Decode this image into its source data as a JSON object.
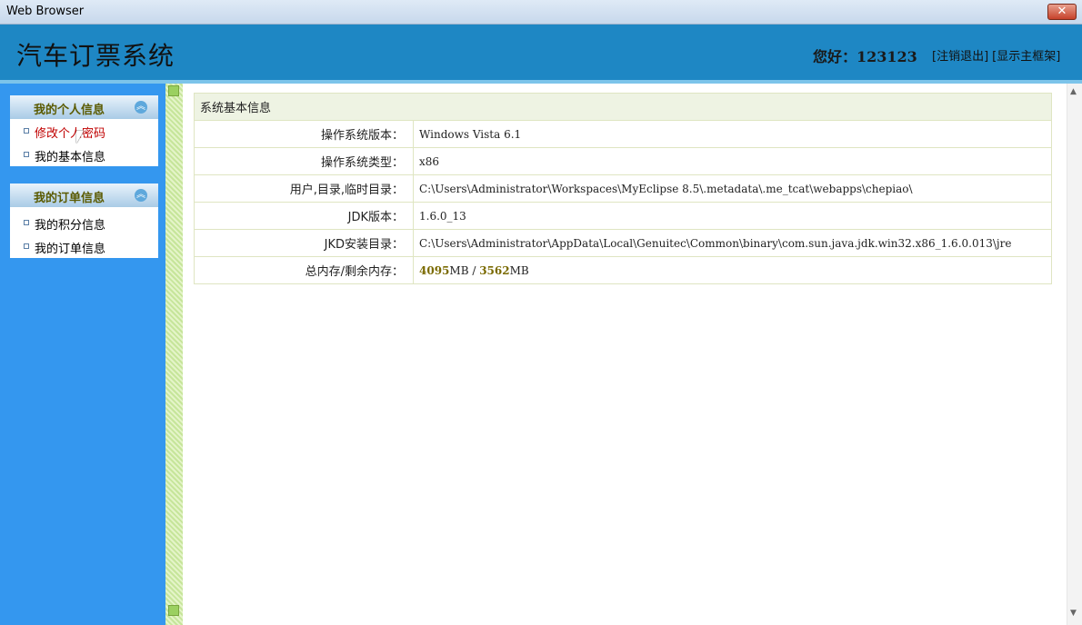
{
  "window": {
    "title": "Web Browser",
    "close_label": "✕"
  },
  "header": {
    "system_name": "汽车订票系统",
    "greeting": "您好：123123",
    "logout_label": "[注销退出]",
    "show_frame_label": "[显示主框架]"
  },
  "sidebar": {
    "panels": [
      {
        "title": "我的个人信息",
        "items": [
          {
            "label": "修改个人密码"
          },
          {
            "label": "我的基本信息"
          }
        ]
      },
      {
        "title": "我的订单信息",
        "items": [
          {
            "label": "我的积分信息"
          },
          {
            "label": "我的订单信息"
          }
        ]
      }
    ]
  },
  "info": {
    "caption": "系统基本信息",
    "rows": [
      {
        "key": "操作系统版本：",
        "value": "Windows Vista  6.1"
      },
      {
        "key": "操作系统类型：",
        "value": "x86"
      },
      {
        "key": "用户,目录,临时目录：",
        "value": "C:\\Users\\Administrator\\Workspaces\\MyEclipse 8.5\\.metadata\\.me_tcat\\webapps\\chepiao\\"
      },
      {
        "key": "JDK版本：",
        "value": "1.6.0_13"
      },
      {
        "key": "JKD安装目录：",
        "value": "C:\\Users\\Administrator\\AppData\\Local\\Genuitec\\Common\\binary\\com.sun.java.jdk.win32.x86_1.6.0.013\\jre"
      }
    ],
    "memory": {
      "key": "总内存/剩余内存：",
      "total": "4095",
      "total_unit": "MB",
      "sep": " / ",
      "free": "3562",
      "free_unit": "MB"
    }
  },
  "colors": {
    "banner": "#1e87c4",
    "sidebar": "#3497ef",
    "active_link": "#c00000"
  }
}
